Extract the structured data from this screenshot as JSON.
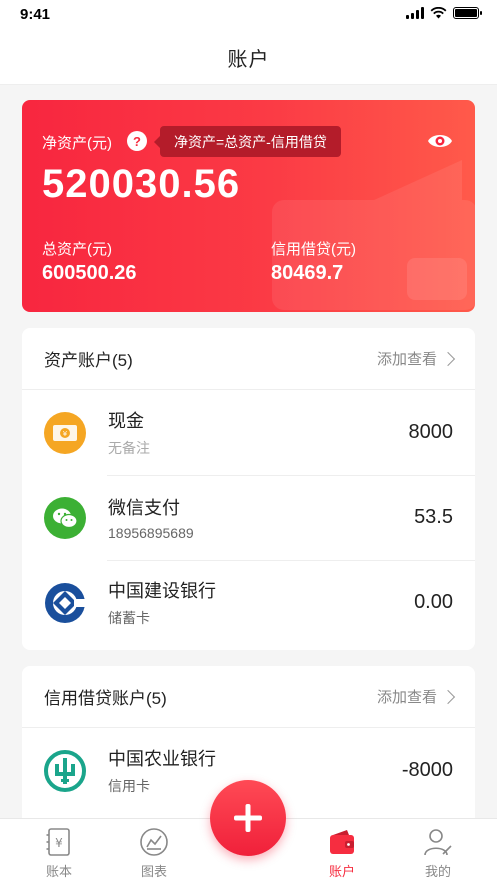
{
  "status": {
    "time": "9:41"
  },
  "nav": {
    "title": "账户"
  },
  "summary": {
    "net_label": "净资产(元)",
    "help_glyph": "?",
    "tooltip": "净资产=总资产-信用借贷",
    "net_value": "520030.56",
    "assets_label": "总资产(元)",
    "assets_value": "600500.26",
    "credit_label": "信用借贷(元)",
    "credit_value": "80469.7",
    "accent_color": "#f62d40"
  },
  "asset_section": {
    "title": "资产账户(5)",
    "action": "添加查看",
    "items": [
      {
        "name": "现金",
        "sub": "无备注",
        "amount": "8000",
        "icon": "cash-icon",
        "color": "#f5a623"
      },
      {
        "name": "微信支付",
        "sub": "18956895689",
        "amount": "53.5",
        "icon": "wechat-icon",
        "color": "#3cb034"
      },
      {
        "name": "中国建设银行",
        "sub": "储蓄卡",
        "amount": "0.00",
        "icon": "ccb-bank-icon",
        "color": "#1a4f9c"
      }
    ]
  },
  "credit_section": {
    "title": "信用借贷账户(5)",
    "action": "添加查看",
    "items": [
      {
        "name": "中国农业银行",
        "sub": "信用卡",
        "amount": "-8000",
        "icon": "abc-bank-icon",
        "color": "#1aa58b"
      }
    ]
  },
  "tabs": [
    {
      "label": "账本",
      "icon": "ledger-icon"
    },
    {
      "label": "图表",
      "icon": "chart-icon"
    },
    {
      "label": "账户",
      "icon": "wallet-icon",
      "active": true
    },
    {
      "label": "我的",
      "icon": "profile-icon"
    }
  ]
}
